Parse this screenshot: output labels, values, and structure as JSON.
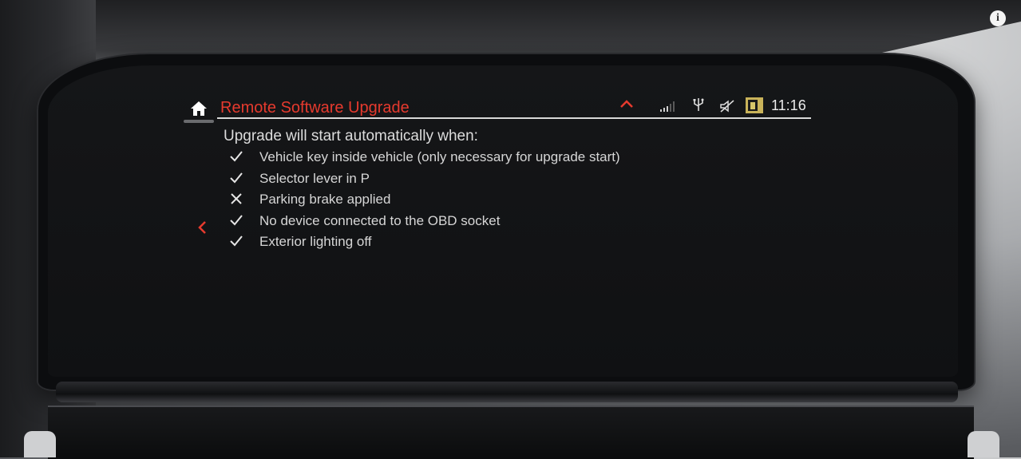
{
  "header": {
    "title": "Remote Software Upgrade",
    "time": "11:16",
    "accent_color": "#e63a2e",
    "icons": [
      "home-icon",
      "chevron-up-icon",
      "signal-icon",
      "usb-icon",
      "speaker-mute-icon",
      "driver-profile-icon"
    ]
  },
  "overlay": {
    "info_icon": "info-icon",
    "info_glyph": "i"
  },
  "main": {
    "intro": "Upgrade will start automatically when:",
    "conditions": [
      {
        "label": "Vehicle key inside vehicle (only necessary for upgrade start)",
        "status": "check-icon"
      },
      {
        "label": "Selector lever in P",
        "status": "check-icon"
      },
      {
        "label": "Parking brake applied",
        "status": "cross-icon"
      },
      {
        "label": "No device connected to the OBD socket",
        "status": "check-icon"
      },
      {
        "label": "Exterior lighting off",
        "status": "check-icon"
      }
    ]
  },
  "nav": {
    "back_icon": "chevron-left-icon"
  }
}
